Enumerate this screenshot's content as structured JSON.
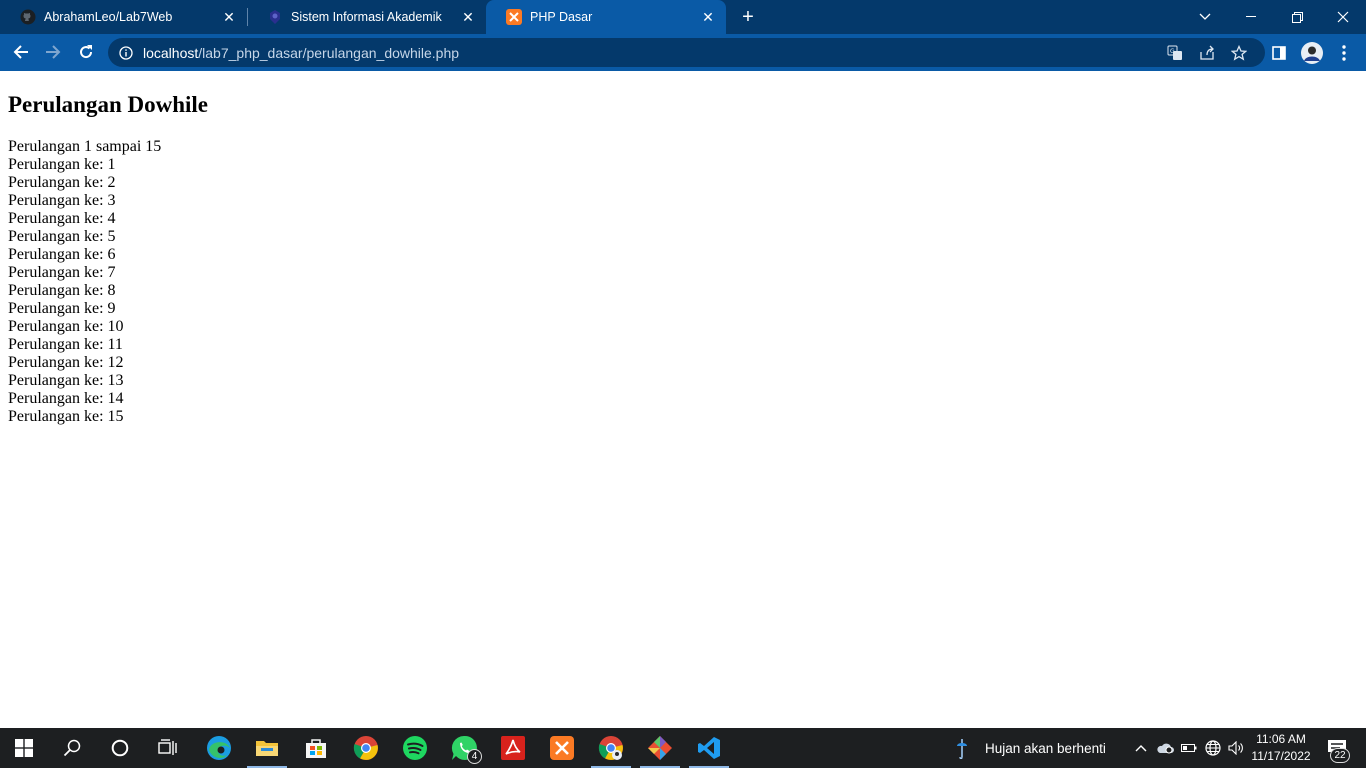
{
  "browser": {
    "tabs": [
      {
        "title": "AbrahamLeo/Lab7Web",
        "icon": "github-icon",
        "active": false
      },
      {
        "title": "Sistem Informasi Akademik",
        "icon": "site-favicon-icon",
        "active": false
      },
      {
        "title": "PHP Dasar",
        "icon": "xampp-icon",
        "active": true
      }
    ],
    "url_host": "localhost",
    "url_path": "/lab7_php_dasar/perulangan_dowhile.php",
    "colors": {
      "tabstrip": "#04396b",
      "toolbar": "#0a5aa6",
      "omnibox": "#04396b"
    }
  },
  "page": {
    "heading": "Perulangan Dowhile",
    "intro": "Perulangan 1 sampai 15",
    "lines": [
      "Perulangan ke: 1",
      "Perulangan ke: 2",
      "Perulangan ke: 3",
      "Perulangan ke: 4",
      "Perulangan ke: 5",
      "Perulangan ke: 6",
      "Perulangan ke: 7",
      "Perulangan ke: 8",
      "Perulangan ke: 9",
      "Perulangan ke: 10",
      "Perulangan ke: 11",
      "Perulangan ke: 12",
      "Perulangan ke: 13",
      "Perulangan ke: 14",
      "Perulangan ke: 15"
    ]
  },
  "taskbar": {
    "apps": [
      "start-icon",
      "search-icon",
      "cortana-icon",
      "task-view-icon",
      "edge-icon",
      "file-explorer-icon",
      "store-icon",
      "chrome-icon",
      "spotify-icon",
      "whatsapp-icon",
      "acrobat-icon",
      "xampp-icon",
      "chrome-profile-icon",
      "git-icon",
      "vscode-icon"
    ],
    "whatsapp_badge": "4",
    "weather_text": "Hujan akan berhenti",
    "time": "11:06 AM",
    "date": "11/17/2022",
    "notification_count": "22"
  }
}
